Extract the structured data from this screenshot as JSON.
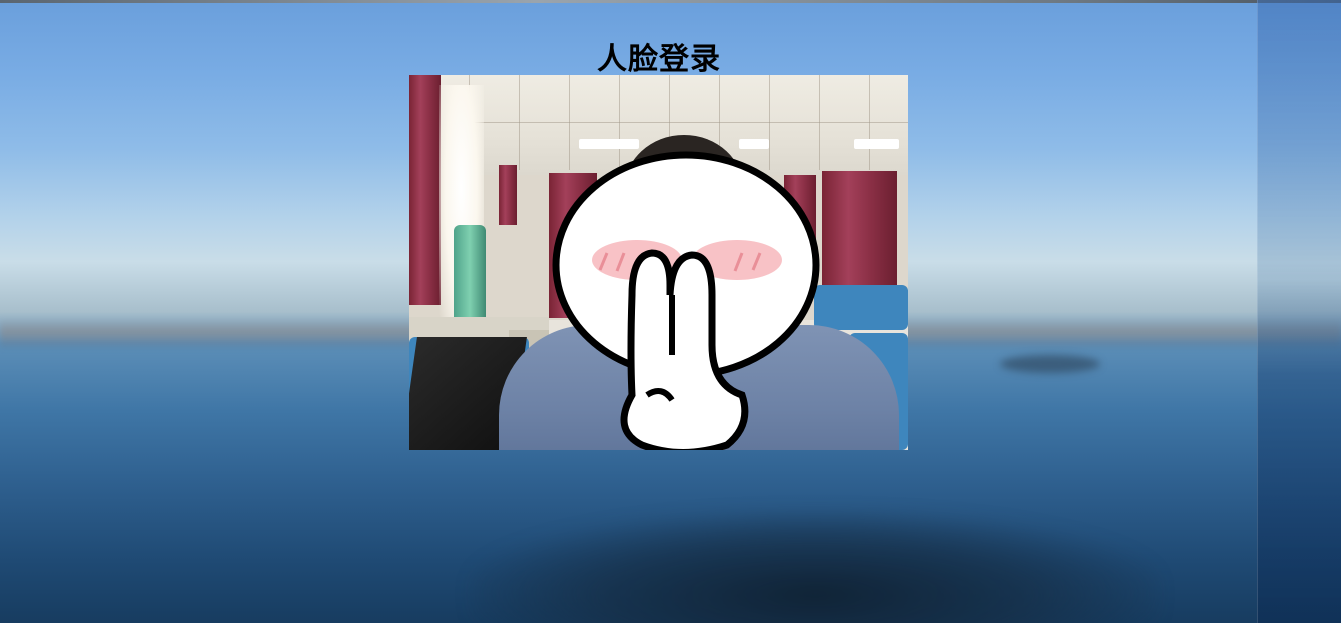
{
  "page": {
    "title": "人脸登录"
  },
  "camera": {
    "label": "webcam-feed"
  },
  "colors": {
    "sky_top": "#6a9fdc",
    "sea_bottom": "#173c60",
    "title_text": "#000000"
  }
}
